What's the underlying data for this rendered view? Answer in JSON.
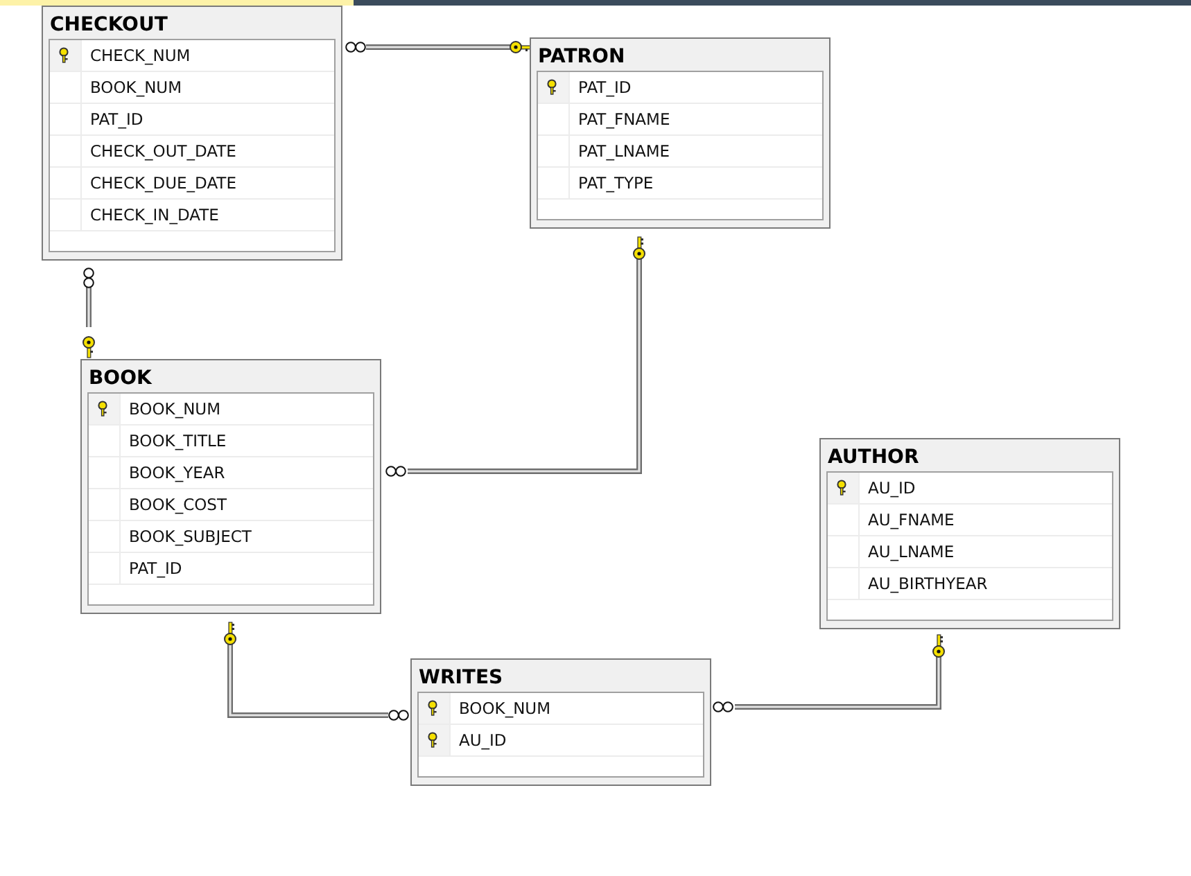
{
  "tables": [
    {
      "name": "CHECKOUT",
      "columns": [
        {
          "name": "CHECK_NUM",
          "primary_key": true
        },
        {
          "name": "BOOK_NUM",
          "primary_key": false
        },
        {
          "name": "PAT_ID",
          "primary_key": false
        },
        {
          "name": "CHECK_OUT_DATE",
          "primary_key": false
        },
        {
          "name": "CHECK_DUE_DATE",
          "primary_key": false
        },
        {
          "name": "CHECK_IN_DATE",
          "primary_key": false
        }
      ]
    },
    {
      "name": "PATRON",
      "columns": [
        {
          "name": "PAT_ID",
          "primary_key": true
        },
        {
          "name": "PAT_FNAME",
          "primary_key": false
        },
        {
          "name": "PAT_LNAME",
          "primary_key": false
        },
        {
          "name": "PAT_TYPE",
          "primary_key": false
        }
      ]
    },
    {
      "name": "BOOK",
      "columns": [
        {
          "name": "BOOK_NUM",
          "primary_key": true
        },
        {
          "name": "BOOK_TITLE",
          "primary_key": false
        },
        {
          "name": "BOOK_YEAR",
          "primary_key": false
        },
        {
          "name": "BOOK_COST",
          "primary_key": false
        },
        {
          "name": "BOOK_SUBJECT",
          "primary_key": false
        },
        {
          "name": "PAT_ID",
          "primary_key": false
        }
      ]
    },
    {
      "name": "AUTHOR",
      "columns": [
        {
          "name": "AU_ID",
          "primary_key": true
        },
        {
          "name": "AU_FNAME",
          "primary_key": false
        },
        {
          "name": "AU_LNAME",
          "primary_key": false
        },
        {
          "name": "AU_BIRTHYEAR",
          "primary_key": false
        }
      ]
    },
    {
      "name": "WRITES",
      "columns": [
        {
          "name": "BOOK_NUM",
          "primary_key": true
        },
        {
          "name": "AU_ID",
          "primary_key": true
        }
      ]
    }
  ]
}
